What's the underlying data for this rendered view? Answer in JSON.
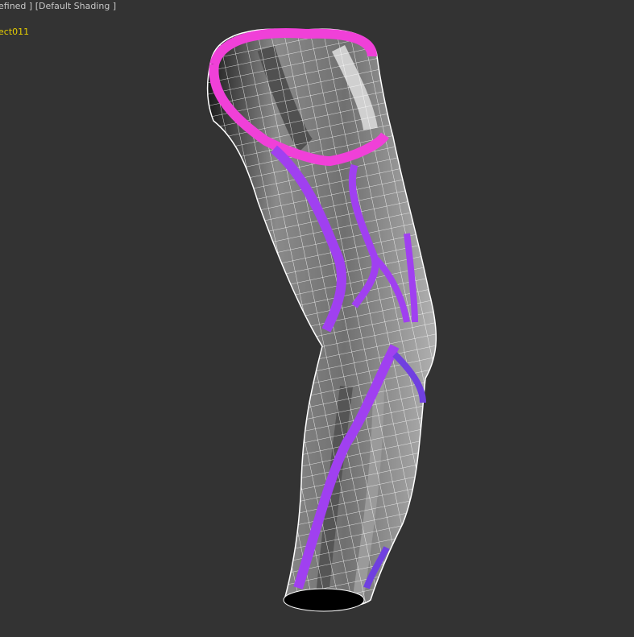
{
  "viewport": {
    "label": "efined ] [Default Shading ]",
    "object_name": "ect011"
  },
  "colors": {
    "background": "#333333",
    "seam_magenta": "#f040d8",
    "seam_purple": "#a040f0",
    "seam_violet": "#7040e0",
    "wire": "#ffffff",
    "object_label": "#e8d000"
  }
}
